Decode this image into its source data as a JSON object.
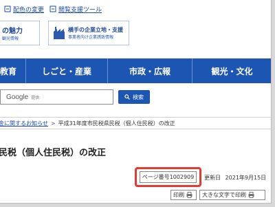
{
  "utility_bar": {
    "color_change": "配色の変更",
    "reading_tool": "閲覧支援ツール"
  },
  "banners": {
    "left_title": "の魅力",
    "left_sub": "観光情報",
    "right_title": "横手の企業立地・支援",
    "right_sub": "事業者向け企業誘致情報"
  },
  "nav": {
    "items": [
      "教育",
      "しごと・産業",
      "市政・広報",
      "観光・文化"
    ]
  },
  "search": {
    "google_label": "Google",
    "provider_label": "提供",
    "button_label": "検索"
  },
  "breadcrumb": {
    "link_text": "金に関するお知らせ",
    "separator": ">",
    "current": "平成31年度市民税県民税（個人住民税）の改正"
  },
  "page": {
    "title": "民税（個人住民税）の改正",
    "page_number": "ページ番号1002909",
    "updated_label": "更新日",
    "updated_date": "2021年9月15日",
    "print_label": "印刷",
    "large_print_label": "大きな文字で印刷"
  },
  "colors": {
    "nav_bg": "#1d55b3",
    "highlight_border": "#e53935",
    "link": "#1a4aa6"
  }
}
